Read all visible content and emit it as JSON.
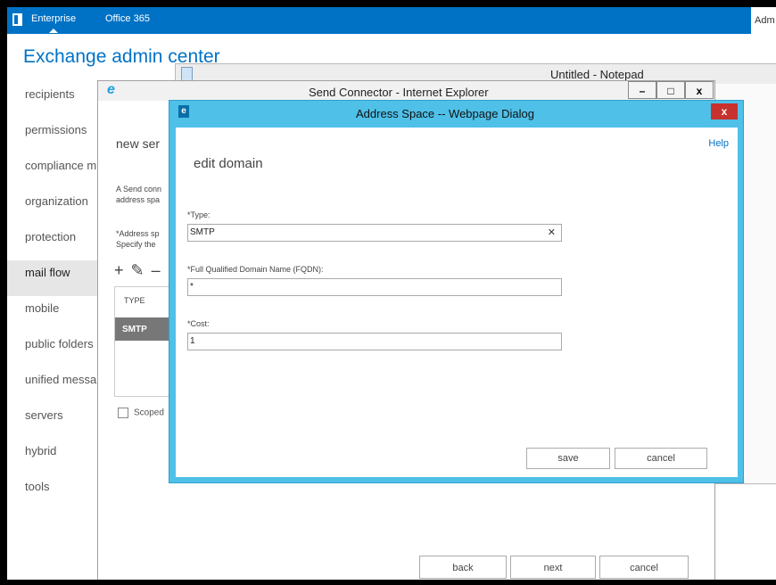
{
  "top_bar": {
    "tabs": [
      "Enterprise",
      "Office 365"
    ],
    "admin_label": "Adm"
  },
  "eac": {
    "title": "Exchange admin center",
    "nav": [
      "recipients",
      "permissions",
      "compliance m",
      "organization",
      "protection",
      "mail flow",
      "mobile",
      "public folders",
      "unified messa",
      "servers",
      "hybrid",
      "tools"
    ],
    "selected_nav": "mail flow"
  },
  "notepad": {
    "title": "Untitled - Notepad"
  },
  "ie_window": {
    "title": "Send Connector - Internet Explorer",
    "min": "–",
    "max": "□",
    "close": "x",
    "heading": "new ser",
    "desc_line1": "A Send conn",
    "desc_line2": "address spa",
    "addr_line1": "*Address sp",
    "addr_line2": "Specify the",
    "toolbar": [
      "+",
      "✎",
      "–"
    ],
    "table_header": "TYPE",
    "table_row": "SMTP",
    "scoped_label": "Scoped",
    "buttons": {
      "back": "back",
      "next": "next",
      "cancel": "cancel"
    }
  },
  "dialog": {
    "title": "Address Space -- Webpage Dialog",
    "close": "x",
    "help": "Help",
    "heading": "edit domain",
    "type_label": "*Type:",
    "type_value": "SMTP",
    "fqdn_label": "*Full Qualified Domain Name (FQDN):",
    "fqdn_value": "*",
    "cost_label": "*Cost:",
    "cost_value": "1",
    "save": "save",
    "cancel": "cancel"
  }
}
